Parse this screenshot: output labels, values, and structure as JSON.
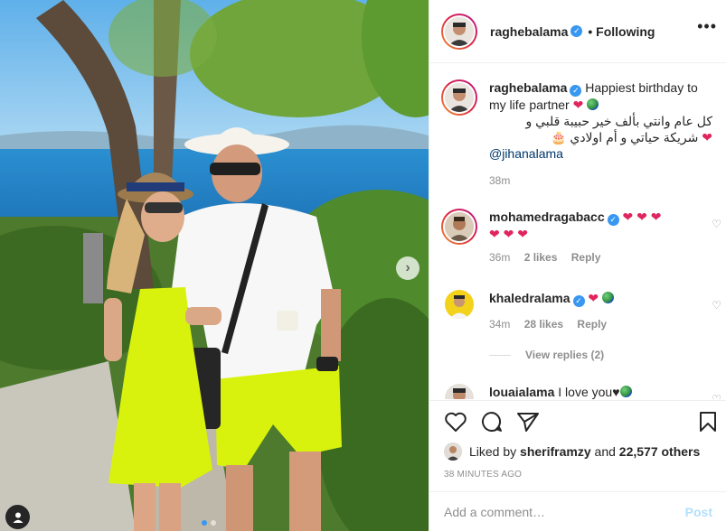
{
  "post": {
    "username": "raghebalama",
    "following_label": "• Following",
    "more_label": "•••",
    "caption_text": "Happiest birthday to my life partner",
    "caption_arabic_line1": "كل عام وانتي بألف خير حبيبة قلبي و",
    "caption_arabic_line2": "شريكة حياتي و أم اولادي",
    "caption_mention": "@jihanalama",
    "caption_time": "38m"
  },
  "comments": [
    {
      "username": "mohamedragabacc",
      "hearts_line1": "❤ ❤ ❤",
      "hearts_line2": "❤ ❤ ❤",
      "time": "36m",
      "likes": "2 likes",
      "reply": "Reply"
    },
    {
      "username": "khaledralama",
      "text": "❤",
      "time": "34m",
      "likes": "28 likes",
      "reply": "Reply",
      "view_replies": "View replies (2)"
    },
    {
      "username": "louaialama",
      "text": "I love you"
    }
  ],
  "footer": {
    "liked_by_prefix": "Liked by",
    "liked_by_user": "sherifr amzy",
    "liked_by_user_exact": "sheriframzy",
    "liked_and": "and",
    "liked_others": "22,577 others",
    "time_ago": "38 MINUTES AGO",
    "comment_placeholder": "Add a comment…",
    "post_label": "Post"
  },
  "icons": {
    "like": "heart-outline-icon",
    "comment": "comment-bubble-icon",
    "share": "paper-plane-icon",
    "save": "bookmark-icon",
    "next": "chevron-right-icon",
    "tag": "person-tag-icon"
  },
  "colors": {
    "verified": "#3897f0",
    "link": "#00376b",
    "muted": "#8e8e8e",
    "heart": "#e0245e",
    "post_disabled": "#b2dffc"
  }
}
